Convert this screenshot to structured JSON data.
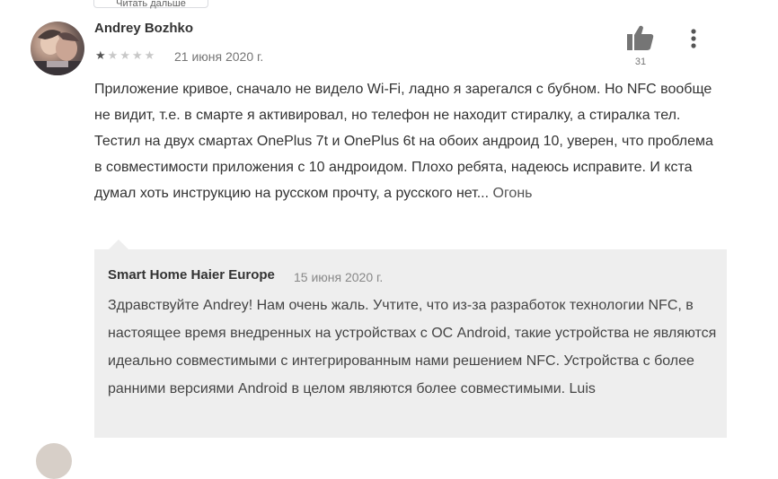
{
  "top": {
    "read_more_label": "Читать дальше"
  },
  "review": {
    "author": "Andrey Bozhko",
    "rating": 1,
    "rating_max": 5,
    "date": "21 июня 2020 г.",
    "helpful_count": "31",
    "text": "Приложение кривое, сначало не видело Wi-Fi, ладно я зарегался с бубном. Но NFC вообще не видит, т.е. в смарте я активировал, но телефон не находит стиралку, а стиралка тел. Тестил на двух смартах OnePlus 7t и OnePlus 6t на обоих андроид 10, уверен, что проблема в совместимости приложения с 10 андроидом. Плохо ребята, надеюсь исправите. И кста думал хоть инструкцию на русском прочту, а русского нет...",
    "text_more": " Огонь"
  },
  "reply": {
    "developer": "Smart Home Haier Europe",
    "date": "15 июня 2020 г.",
    "text": "Здравствуйте Andrey! Нам очень жаль. Учтите, что из-за разработок технологии NFC, в настоящее время внедренных на устройствах с ОС Android, такие устройства не являются идеально совместимыми с интегрированным нами решением NFC. Устройства с более ранними версиями Android в целом являются более совместимыми. Luis"
  },
  "icons": {
    "like": "thumbs-up-icon",
    "more": "more-vert-icon",
    "star": "star-icon"
  },
  "colors": {
    "text": "#333333",
    "muted": "#757575",
    "reply_bg": "#eeeeee",
    "star_on": "#555555",
    "star_off": "#c8c8c8"
  }
}
